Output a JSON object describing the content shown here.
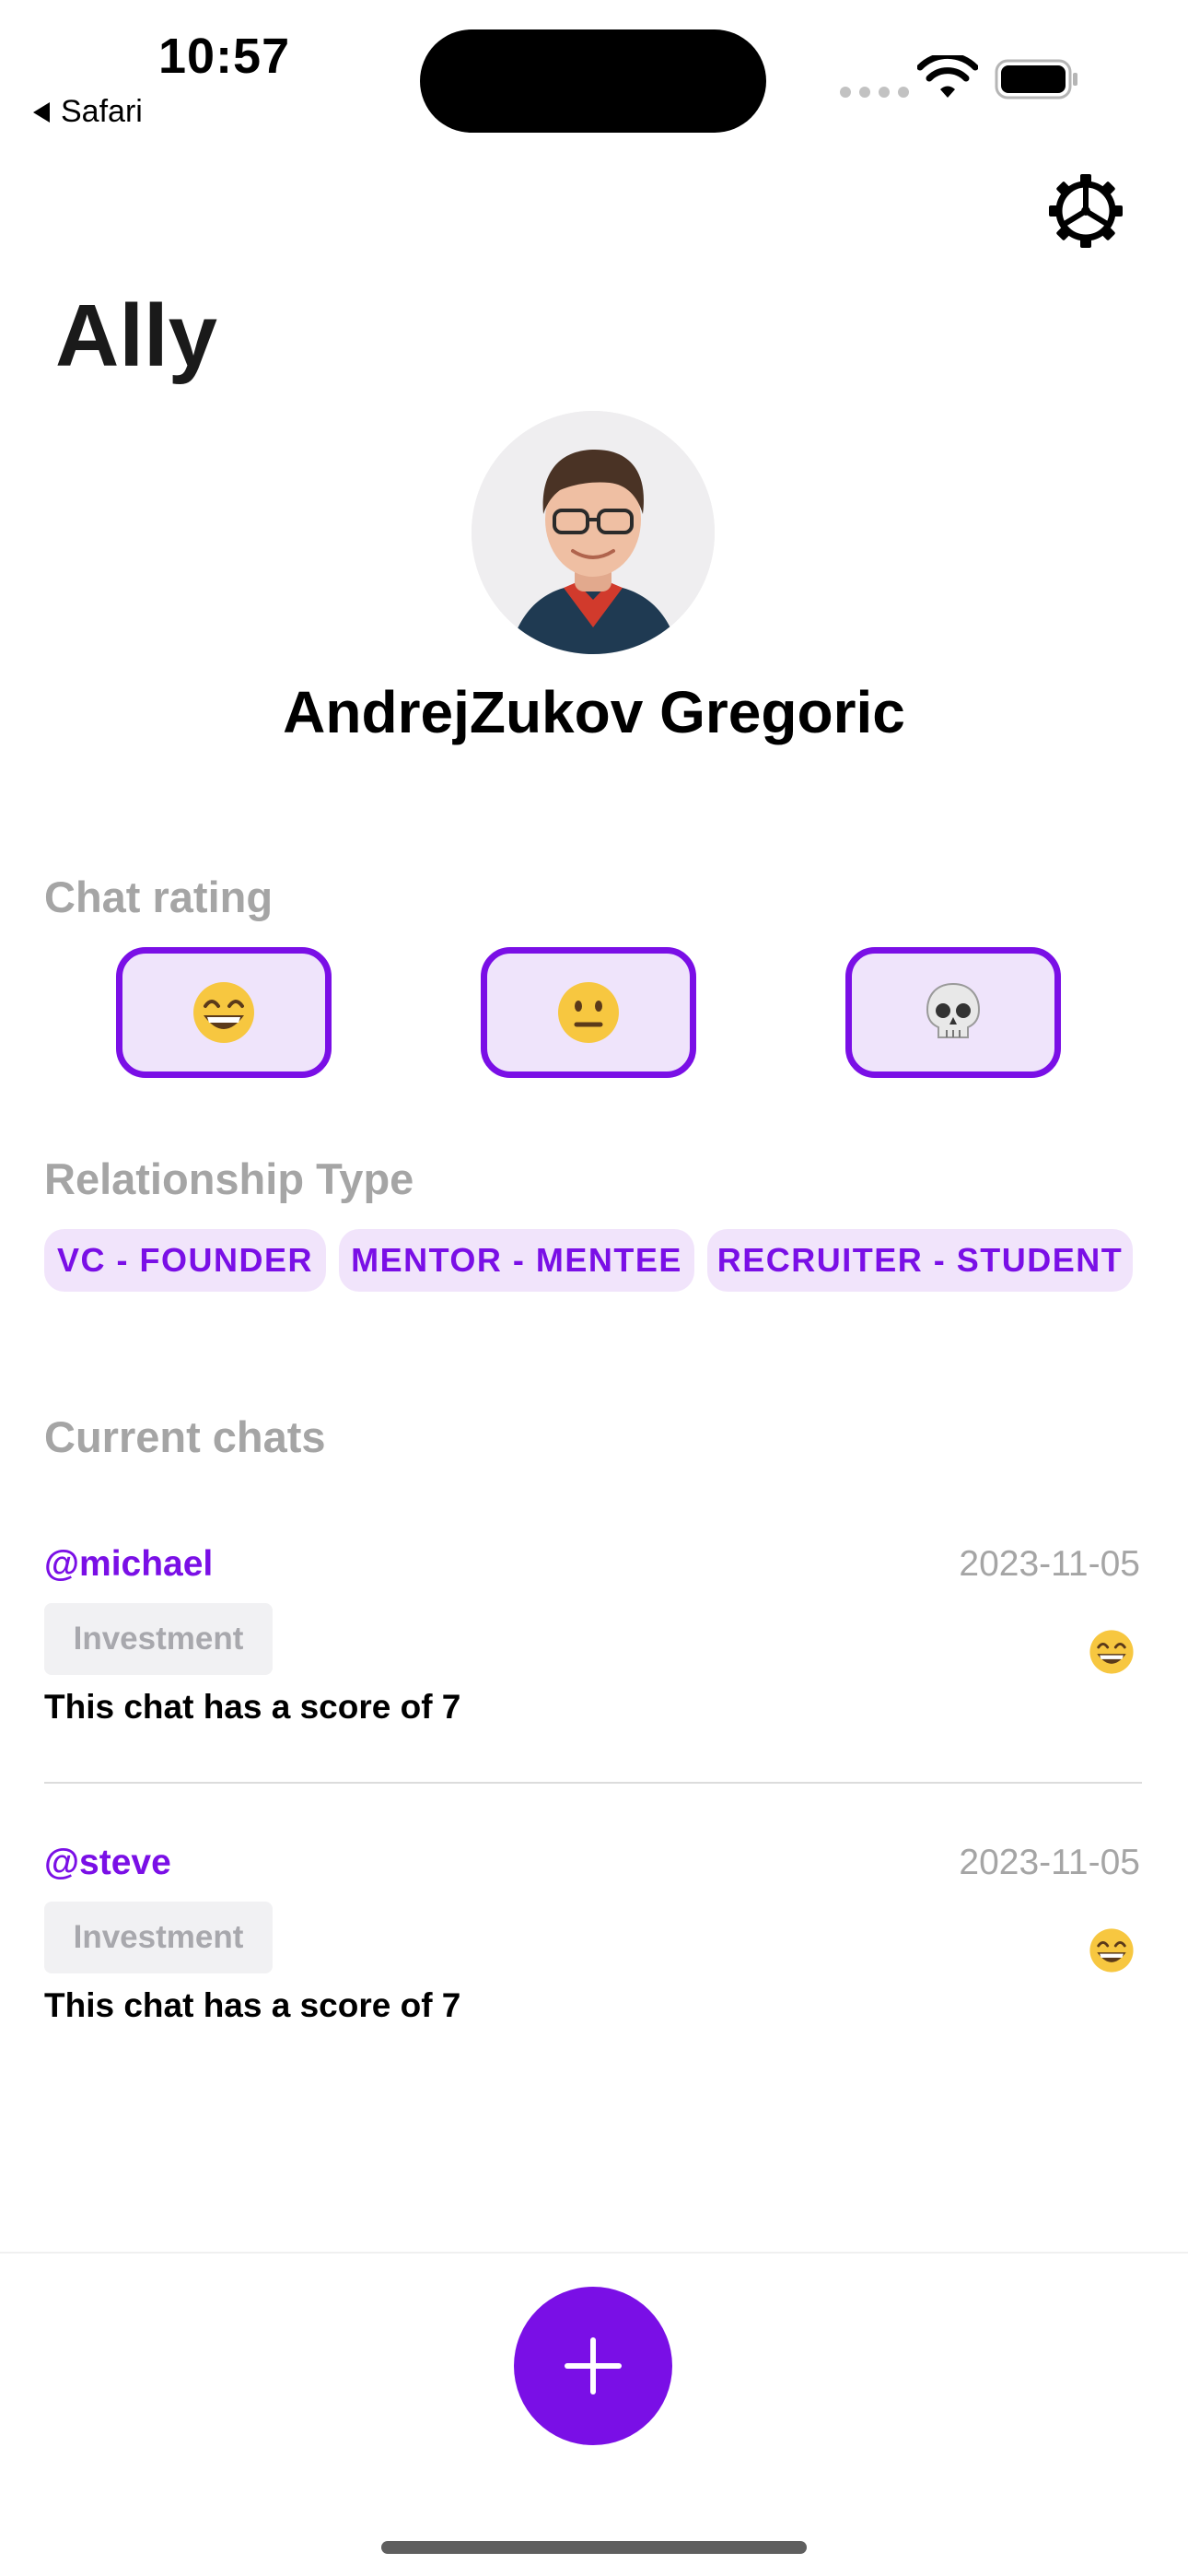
{
  "status_bar": {
    "time": "10:57",
    "back_app": "Safari"
  },
  "header": {
    "title": "Ally",
    "settings_icon": "gear-icon"
  },
  "profile": {
    "name": "AndrejZukov Gregoric",
    "avatar_icon": "avatar"
  },
  "chat_rating": {
    "label": "Chat rating",
    "options": [
      {
        "icon": "grinning-face-icon"
      },
      {
        "icon": "neutral-face-icon"
      },
      {
        "icon": "skull-icon"
      }
    ]
  },
  "relationship_type": {
    "label": "Relationship Type",
    "options": [
      "VC - FOUNDER",
      "MENTOR - MENTEE",
      "RECRUITER - STUDENT"
    ]
  },
  "current_chats": {
    "label": "Current chats",
    "items": [
      {
        "user": "@michael",
        "date": "2023-11-05",
        "tag": "Investment",
        "score_text": "This chat has a score of 7",
        "emoji": "grinning-face-icon"
      },
      {
        "user": "@steve",
        "date": "2023-11-05",
        "tag": "Investment",
        "score_text": "This chat has a score of 7",
        "emoji": "grinning-face-icon"
      }
    ]
  },
  "colors": {
    "accent": "#7A0FE6",
    "accent_light": "#EFE4FB",
    "muted_text": "#A5A5A5",
    "tag_background": "#F1F1F3"
  },
  "fab": {
    "icon": "plus-icon"
  }
}
